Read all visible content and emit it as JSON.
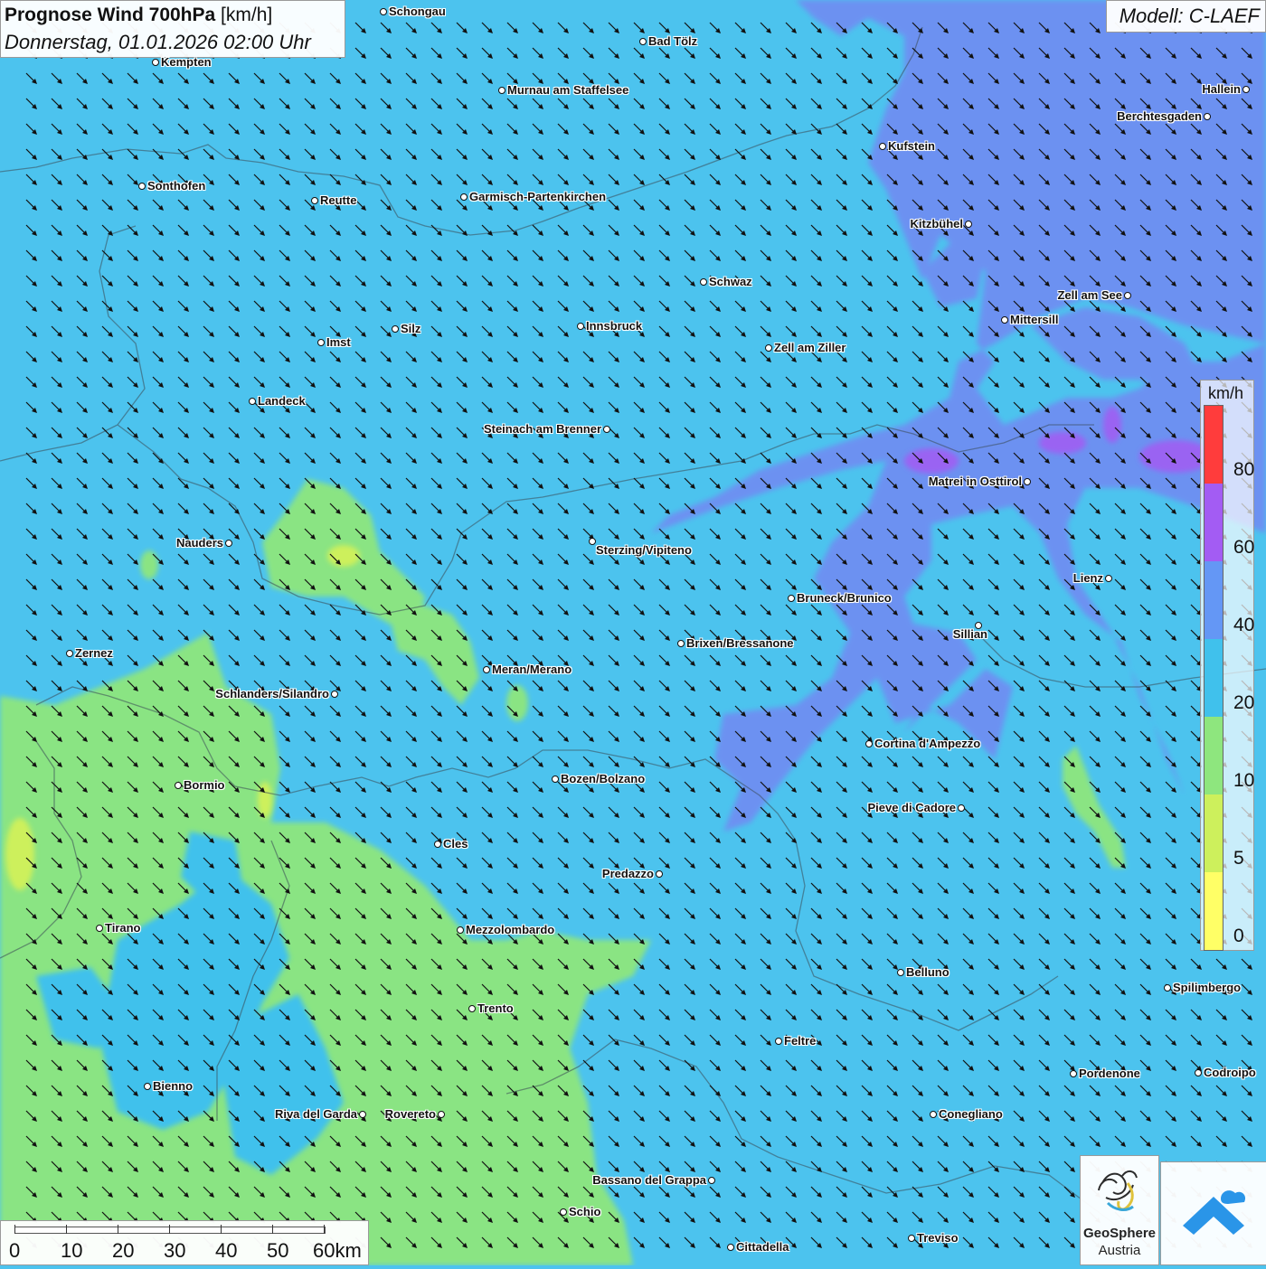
{
  "header": {
    "title_bold": "Prognose Wind 700hPa",
    "title_unit": "[km/h]",
    "datetime": "Donnerstag, 01.01.2026 02:00 Uhr"
  },
  "model_label": "Modell: C-LAEF",
  "legend": {
    "unit": "km/h",
    "ticks": [
      "0",
      "5",
      "10",
      "20",
      "40",
      "60",
      "80"
    ],
    "colors": [
      "#ffff66",
      "#cdf05c",
      "#8ee67e",
      "#40c1ec",
      "#6497f5",
      "#a35cf3",
      "#ff3c3c"
    ]
  },
  "scale_bar": {
    "labels": [
      "0",
      "10",
      "20",
      "30",
      "40",
      "50",
      "60km"
    ]
  },
  "cities": [
    {
      "name": "Schongau",
      "dot": [
        424,
        13
      ],
      "side": "right"
    },
    {
      "name": "Bad Tölz",
      "dot": [
        711,
        46
      ],
      "side": "right"
    },
    {
      "name": "Kempten",
      "dot": [
        172,
        69
      ],
      "side": "right"
    },
    {
      "name": "Murnau am Staffelsee",
      "dot": [
        555,
        100
      ],
      "side": "right"
    },
    {
      "name": "Hallein",
      "dot": [
        1378,
        99
      ],
      "side": "left"
    },
    {
      "name": "Berchtesgaden",
      "dot": [
        1335,
        129
      ],
      "side": "left"
    },
    {
      "name": "Kufstein",
      "dot": [
        976,
        162
      ],
      "side": "right"
    },
    {
      "name": "Sonthofen",
      "dot": [
        157,
        206
      ],
      "side": "right"
    },
    {
      "name": "Reutte",
      "dot": [
        348,
        222
      ],
      "side": "right"
    },
    {
      "name": "Garmisch-Partenkirchen",
      "dot": [
        513,
        218
      ],
      "side": "right"
    },
    {
      "name": "Kitzbühel",
      "dot": [
        1071,
        248
      ],
      "side": "left"
    },
    {
      "name": "Schwaz",
      "dot": [
        778,
        312
      ],
      "side": "right"
    },
    {
      "name": "Zell am See",
      "dot": [
        1247,
        327
      ],
      "side": "left"
    },
    {
      "name": "Mittersill",
      "dot": [
        1111,
        354
      ],
      "side": "right"
    },
    {
      "name": "Innsbruck",
      "dot": [
        642,
        361
      ],
      "side": "right"
    },
    {
      "name": "Silz",
      "dot": [
        437,
        364
      ],
      "side": "right"
    },
    {
      "name": "Imst",
      "dot": [
        355,
        379
      ],
      "side": "right"
    },
    {
      "name": "Zell am Ziller",
      "dot": [
        850,
        385
      ],
      "side": "right"
    },
    {
      "name": "Landeck",
      "dot": [
        279,
        444
      ],
      "side": "right"
    },
    {
      "name": "Steinach am Brenner",
      "dot": [
        671,
        475
      ],
      "side": "left"
    },
    {
      "name": "Matrei in Osttirol",
      "dot": [
        1136,
        533
      ],
      "side": "left"
    },
    {
      "name": "Nauders",
      "dot": [
        253,
        601
      ],
      "side": "left"
    },
    {
      "name": "Sterzing/Vipiteno",
      "dot": [
        655,
        599
      ],
      "side": "below"
    },
    {
      "name": "Lienz",
      "dot": [
        1226,
        640
      ],
      "side": "left"
    },
    {
      "name": "Bruneck/Brunico",
      "dot": [
        875,
        662
      ],
      "side": "right"
    },
    {
      "name": "Sillian",
      "dot": [
        1082,
        692
      ],
      "side": "below-left"
    },
    {
      "name": "Brixen/Bressanone",
      "dot": [
        753,
        712
      ],
      "side": "right"
    },
    {
      "name": "Zernez",
      "dot": [
        77,
        723
      ],
      "side": "right"
    },
    {
      "name": "Meran/Merano",
      "dot": [
        538,
        741
      ],
      "side": "right"
    },
    {
      "name": "Schlanders/Silandro",
      "dot": [
        370,
        768
      ],
      "side": "left"
    },
    {
      "name": "Cortina d'Ampezzo",
      "dot": [
        961,
        823
      ],
      "side": "right"
    },
    {
      "name": "Bozen/Bolzano",
      "dot": [
        614,
        862
      ],
      "side": "right"
    },
    {
      "name": "Bormio",
      "dot": [
        197,
        869
      ],
      "side": "right"
    },
    {
      "name": "Pieve di Cadore",
      "dot": [
        1063,
        894
      ],
      "side": "left"
    },
    {
      "name": "Cles",
      "dot": [
        484,
        934
      ],
      "side": "right"
    },
    {
      "name": "Predazzo",
      "dot": [
        729,
        967
      ],
      "side": "left"
    },
    {
      "name": "Tirano",
      "dot": [
        110,
        1027
      ],
      "side": "right"
    },
    {
      "name": "Mezzolombardo",
      "dot": [
        509,
        1029
      ],
      "side": "right"
    },
    {
      "name": "Belluno",
      "dot": [
        996,
        1076
      ],
      "side": "right"
    },
    {
      "name": "Spilimbergo",
      "dot": [
        1291,
        1093
      ],
      "side": "right"
    },
    {
      "name": "Trento",
      "dot": [
        522,
        1116
      ],
      "side": "right"
    },
    {
      "name": "Feltre",
      "dot": [
        861,
        1152
      ],
      "side": "right"
    },
    {
      "name": "Pordenone",
      "dot": [
        1187,
        1188
      ],
      "side": "right"
    },
    {
      "name": "Codroipo",
      "dot": [
        1325,
        1187
      ],
      "side": "right"
    },
    {
      "name": "Bienno",
      "dot": [
        163,
        1202
      ],
      "side": "right"
    },
    {
      "name": "Riva del Garda",
      "dot": [
        401,
        1233
      ],
      "side": "left"
    },
    {
      "name": "Rovereto",
      "dot": [
        488,
        1233
      ],
      "side": "left"
    },
    {
      "name": "Conegliano",
      "dot": [
        1032,
        1233
      ],
      "side": "right"
    },
    {
      "name": "Bassano del Grappa",
      "dot": [
        787,
        1306
      ],
      "side": "left"
    },
    {
      "name": "Schio",
      "dot": [
        623,
        1341
      ],
      "side": "right"
    },
    {
      "name": "Treviso",
      "dot": [
        1008,
        1370
      ],
      "side": "right"
    },
    {
      "name": "Cittadella",
      "dot": [
        808,
        1380
      ],
      "side": "right"
    }
  ],
  "logos": {
    "geosphere_line1": "GeoSphere",
    "geosphere_line2": "Austria"
  }
}
